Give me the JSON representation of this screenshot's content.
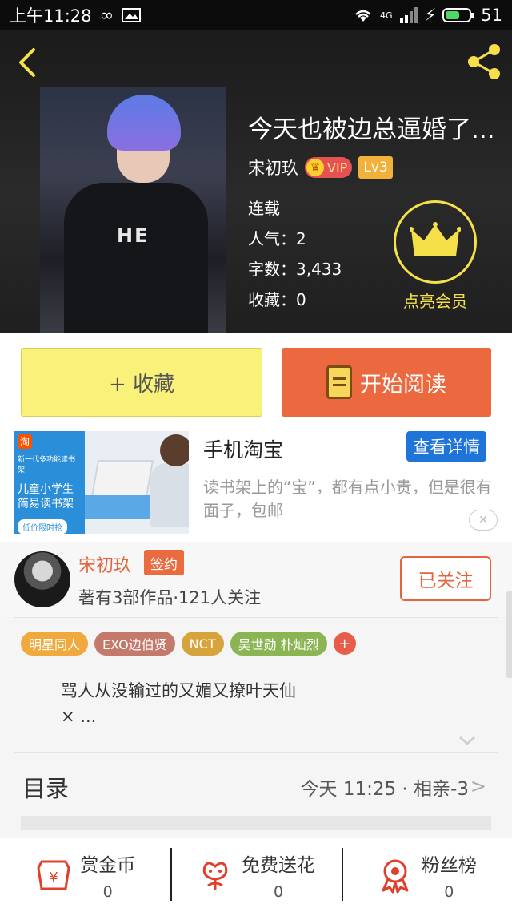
{
  "status_bar": {
    "time": "上午11:28",
    "network": "4G",
    "battery": "51"
  },
  "book": {
    "title": "今天也被边总逼婚了...",
    "author": "宋初玖",
    "vip_label": "VIP",
    "level": "Lv3",
    "status": "连载",
    "popularity": "人气：2",
    "word_count": "字数：3,433",
    "favorites": "收藏：0",
    "cover_text": "HE"
  },
  "member": {
    "label": "点亮会员"
  },
  "actions": {
    "favorite_label": "+ 收藏",
    "read_label": "开始阅读"
  },
  "ad": {
    "title": "手机淘宝",
    "detail_button": "查看详情",
    "description": "读书架上的“宝”，都有点小贵，但是很有面子，包邮",
    "close": "✕",
    "image_text": {
      "logo": "淘",
      "tagline": "新一代多功能读书架",
      "headline": "儿童小学生简易读书架",
      "pill": "低价限时抢"
    }
  },
  "author_card": {
    "name": "宋初玖",
    "sign_badge": "签约",
    "works_info": "著有3部作品·121人关注",
    "follow_button": "已关注"
  },
  "tags": [
    {
      "label": "明星同人",
      "color": "#f0a93c"
    },
    {
      "label": "EXO边伯贤",
      "color": "#c47a6a"
    },
    {
      "label": "NCT",
      "color": "#d6a43b"
    },
    {
      "label": "吴世勋 朴灿烈",
      "color": "#8bb552"
    }
  ],
  "tag_add": "+",
  "intro": "骂人从没输过的又媚又撩叶天仙\n× ...",
  "catalog": {
    "title": "目录",
    "latest": "今天 11:25 · 相亲-3"
  },
  "stats": [
    {
      "label": "赏金币",
      "value": "0",
      "icon": "coin-envelope-icon"
    },
    {
      "label": "免费送花",
      "value": "0",
      "icon": "flower-icon"
    },
    {
      "label": "粉丝榜",
      "value": "0",
      "icon": "medal-icon"
    }
  ],
  "colors": {
    "accent": "#ec6940",
    "favorite_btn": "#faf17a",
    "member_gold": "#f5e04a",
    "ad_blue": "#1e74d8"
  }
}
